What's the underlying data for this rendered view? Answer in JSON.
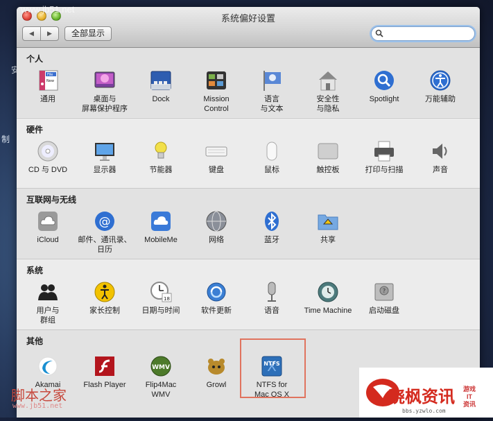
{
  "window": {
    "title": "系统偏好设置"
  },
  "toolbar": {
    "show_all": "全部显示",
    "search_placeholder": ""
  },
  "desktop": {
    "label1": "安",
    "label2": "制"
  },
  "sections": {
    "personal": {
      "title": "个人",
      "items": [
        "通用",
        "桌面与\n屏幕保护程序",
        "Dock",
        "Mission\nControl",
        "语言\n与文本",
        "安全性\n与隐私",
        "Spotlight",
        "万能辅助"
      ]
    },
    "hardware": {
      "title": "硬件",
      "items": [
        "CD 与 DVD",
        "显示器",
        "节能器",
        "键盘",
        "鼠标",
        "触控板",
        "打印与扫描",
        "声音"
      ]
    },
    "internet": {
      "title": "互联网与无线",
      "items": [
        "iCloud",
        "邮件、通讯录、\n日历",
        "MobileMe",
        "网络",
        "蓝牙",
        "共享"
      ]
    },
    "system": {
      "title": "系统",
      "items": [
        "用户与\n群组",
        "家长控制",
        "日期与时间",
        "软件更新",
        "语音",
        "Time Machine",
        "启动磁盘"
      ]
    },
    "other": {
      "title": "其他",
      "items": [
        "Akamai",
        "Flash Player",
        "Flip4Mac\nWMV",
        "Growl",
        "NTFS for\nMac OS X"
      ]
    }
  },
  "icon_text": {
    "general_file": "File",
    "general_new": "New",
    "datetime_day": "18",
    "flip4mac": "WMV",
    "ntfs": "NTFS",
    "ntfs_x": "X"
  },
  "watermarks": {
    "top_left": "www.jb51.net",
    "bottom_left": "脚本之家",
    "bottom_left_url": "www.jb51.net",
    "bottom_right_brand": "晓枫资讯",
    "bottom_right_tag1": "游戏",
    "bottom_right_tag2": "IT",
    "bottom_right_tag3": "资讯",
    "bottom_right_url": "bbs.yzwlo.com"
  },
  "colors": {
    "highlight": "#e0735e",
    "search_focus": "#9cc1ea"
  }
}
